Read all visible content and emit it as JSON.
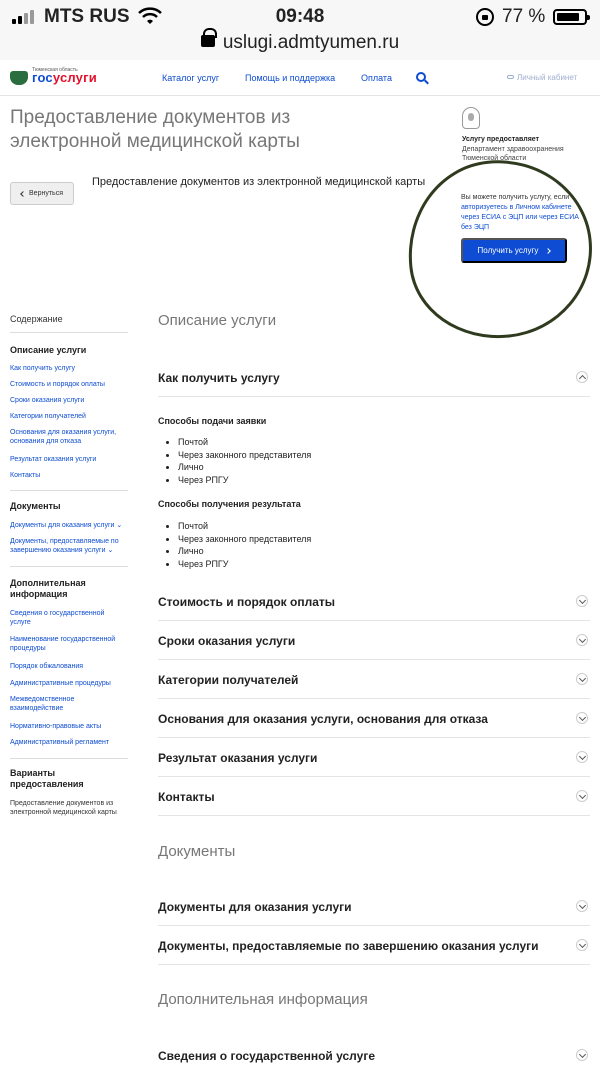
{
  "status_bar": {
    "carrier": "MTS RUS",
    "time": "09:48",
    "battery": "77 %"
  },
  "url_bar": {
    "url": "uslugi.admtyumen.ru"
  },
  "header": {
    "logo_small": "Тюменская область",
    "logo_gos": "гос",
    "logo_uslugi": "услуги",
    "nav": [
      "Каталог услуг",
      "Помощь и поддержка",
      "Оплата"
    ],
    "cabinet": "Личный кабинет"
  },
  "hero": {
    "title": "Предоставление документов из электронной медицинской карты",
    "provider_label": "Услугу предоставляет",
    "provider_name": "Департамент здравоохранения Тюменской области",
    "back_label": "Вернуться",
    "subtitle": "Предоставление документов из электронной медицинской карты",
    "note_prefix": "Вы можете получить услугу, если ",
    "note_link": "авторизуетесь в Личном кабинете через ЕСИА с ЭЦП или через ЕСИА без ЭЦП",
    "get_button": "Получить услугу"
  },
  "sidebar": {
    "heading": "Содержание",
    "sections": [
      {
        "title": "Описание услуги",
        "links": [
          "Как получить услугу",
          "Стоимость и порядок оплаты",
          "Сроки оказания услуги",
          "Категории получателей",
          "Основания для оказания услуги, основания для отказа",
          "Результат оказания услуги",
          "Контакты"
        ]
      },
      {
        "title": "Документы",
        "links": [
          "Документы для оказания услуги ⌄",
          "Документы, предоставляемые по завершению оказания услуги ⌄"
        ]
      },
      {
        "title": "Дополнительная информация",
        "links": [
          "Сведения о государственной услуге",
          "Наименование государственной процедуры",
          "Порядок обжалования",
          "Административные процедуры",
          "Межведомственное взаимодействие",
          "Нормативно-правовые акты",
          "Административный регламент"
        ]
      },
      {
        "title": "Варианты предоставления",
        "text": "Предоставление документов из электронной медицинской карты"
      }
    ]
  },
  "main": {
    "description_head": "Описание услуги",
    "how_to_get": "Как получить услугу",
    "submit_methods_title": "Способы подачи заявки",
    "submit_methods": [
      "Почтой",
      "Через законного представителя",
      "Лично",
      "Через РПГУ"
    ],
    "receive_methods_title": "Способы получения результата",
    "receive_methods": [
      "Почтой",
      "Через законного представителя",
      "Лично",
      "Через РПГУ"
    ],
    "desc_items": [
      "Стоимость и порядок оплаты",
      "Сроки оказания услуги",
      "Категории получателей",
      "Основания для оказания услуги, основания для отказа",
      "Результат оказания услуги",
      "Контакты"
    ],
    "documents_head": "Документы",
    "doc_items": [
      "Документы для оказания услуги",
      "Документы, предоставляемые по завершению оказания услуги"
    ],
    "additional_head": "Дополнительная информация",
    "additional_items": [
      "Сведения о государственной услуге"
    ]
  }
}
